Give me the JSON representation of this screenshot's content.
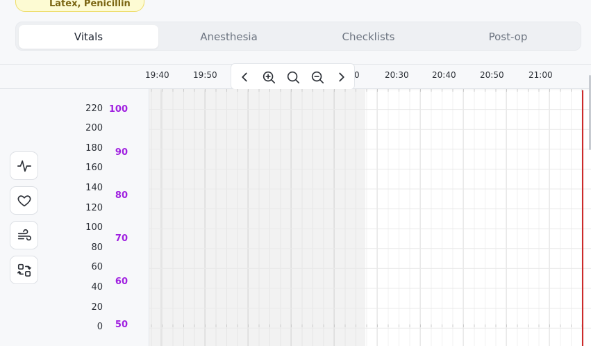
{
  "status_badge": {
    "text": "Latex, Penicillin"
  },
  "tabs": [
    {
      "label": "Vitals",
      "active": true
    },
    {
      "label": "Anesthesia",
      "active": false
    },
    {
      "label": "Checklists",
      "active": false
    },
    {
      "label": "Post-op",
      "active": false
    }
  ],
  "timeline": {
    "labels": [
      "19:40",
      "19:50",
      "0",
      "20:30",
      "20:40",
      "20:50",
      "21:00"
    ]
  },
  "toolbar": {
    "buttons": [
      "chevron-left-icon",
      "zoom-in-icon",
      "zoom-reset-icon",
      "zoom-out-icon",
      "chevron-right-icon"
    ]
  },
  "axes": {
    "bp_ticks": [
      "220",
      "200",
      "180",
      "160",
      "140",
      "120",
      "100",
      "80",
      "60",
      "40",
      "20",
      "0"
    ],
    "hr_ticks": [
      "100",
      "90",
      "80",
      "70",
      "60",
      "50"
    ]
  },
  "side_buttons": [
    "activity-icon",
    "heart-icon",
    "wind-icon",
    "swap-icon"
  ],
  "colors": {
    "accent_purple": "#a020e0",
    "now_line": "#cc2a2a",
    "badge_bg": "#fdfbd3",
    "badge_text": "#7a6512"
  }
}
